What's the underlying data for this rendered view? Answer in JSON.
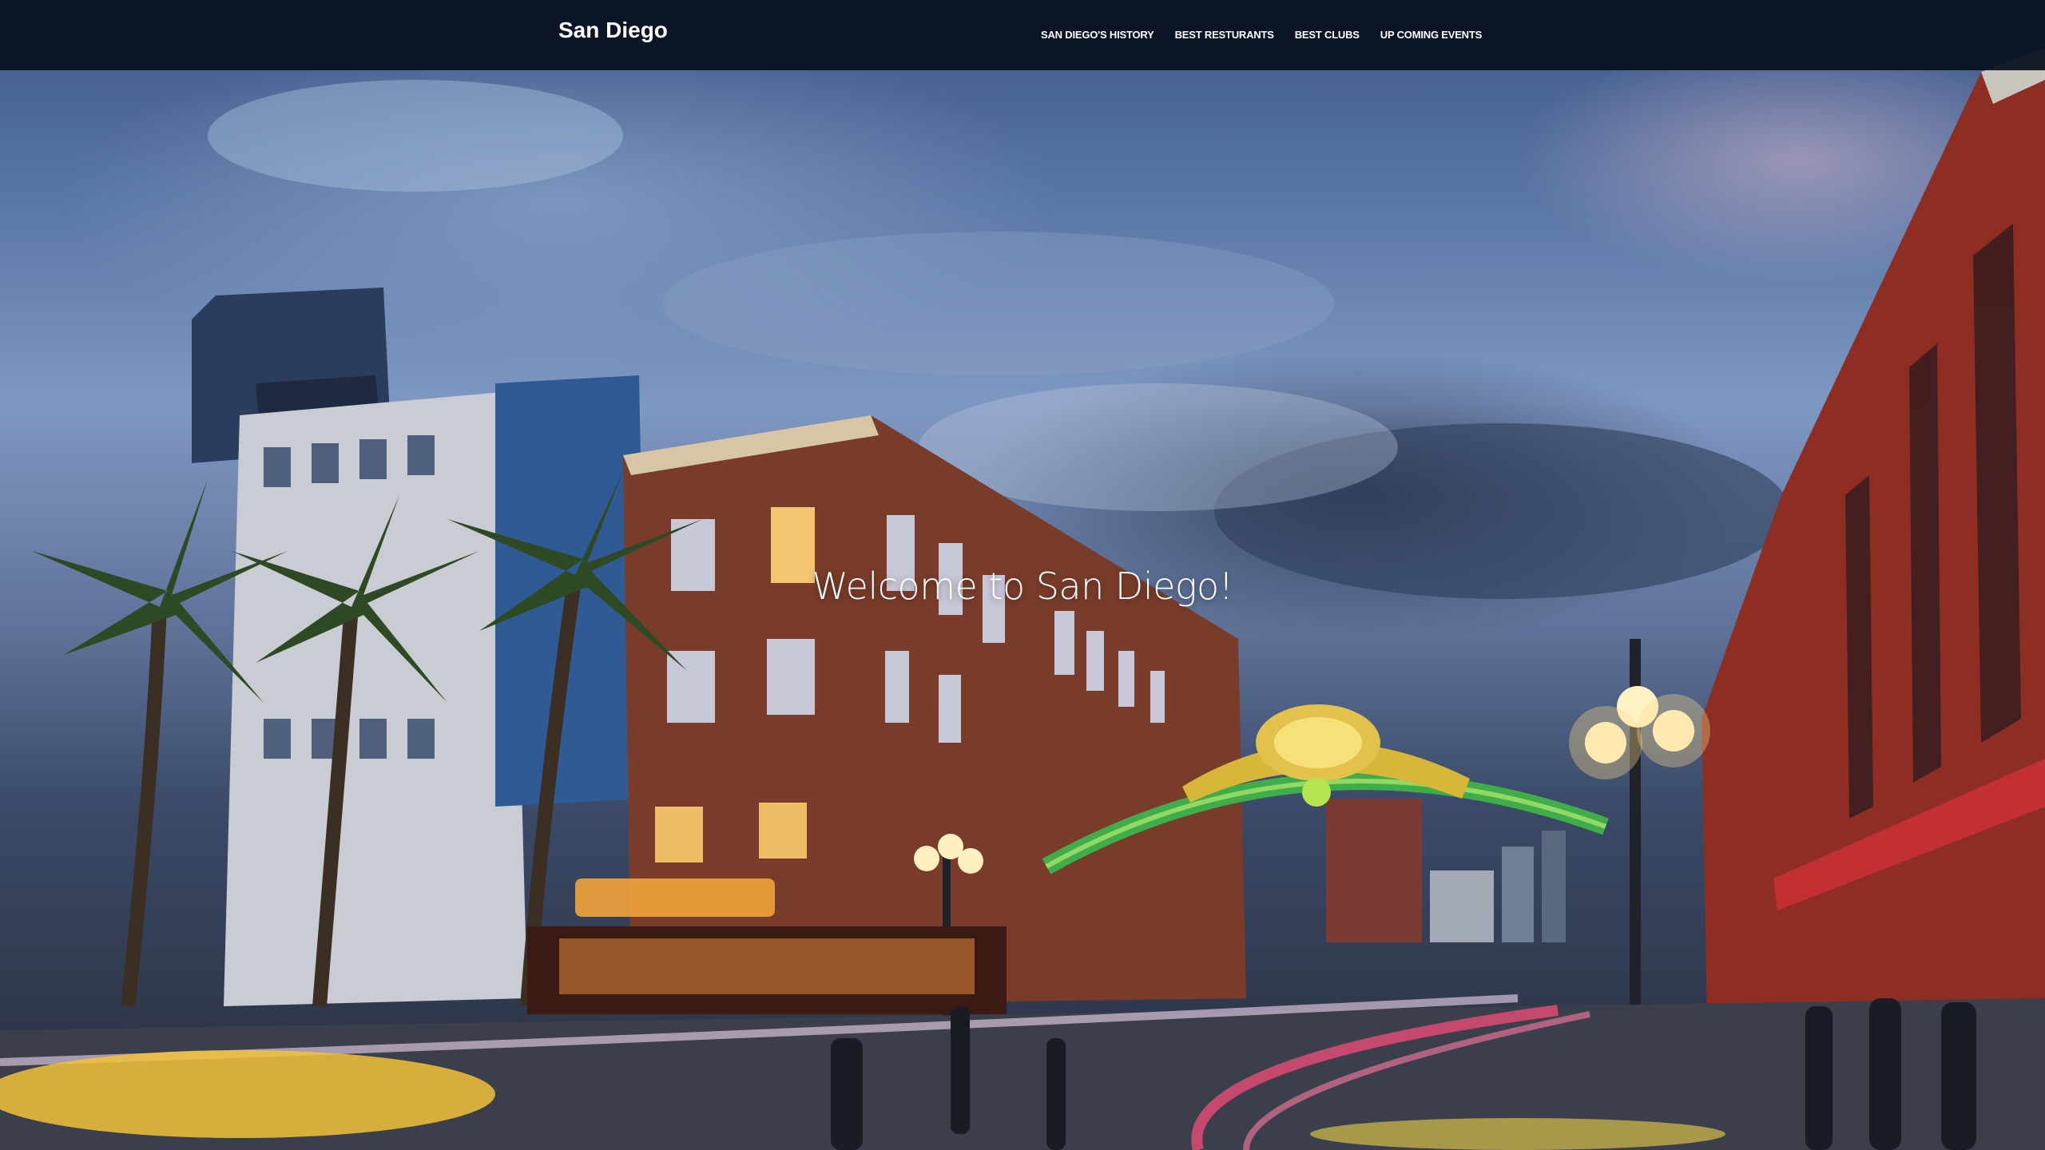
{
  "navbar": {
    "brand": "San Diego",
    "links": [
      {
        "label": "SAN DIEGO'S HISTORY"
      },
      {
        "label": "BEST RESTURANTS"
      },
      {
        "label": "BEST CLUBS"
      },
      {
        "label": "UP COMING EVENTS"
      }
    ]
  },
  "hero": {
    "headline": "Welcome to San Diego!",
    "image": "gaslamp-quarter-street-photo"
  },
  "colors": {
    "navbar_bg": "#08101e",
    "text": "#ffffff"
  }
}
